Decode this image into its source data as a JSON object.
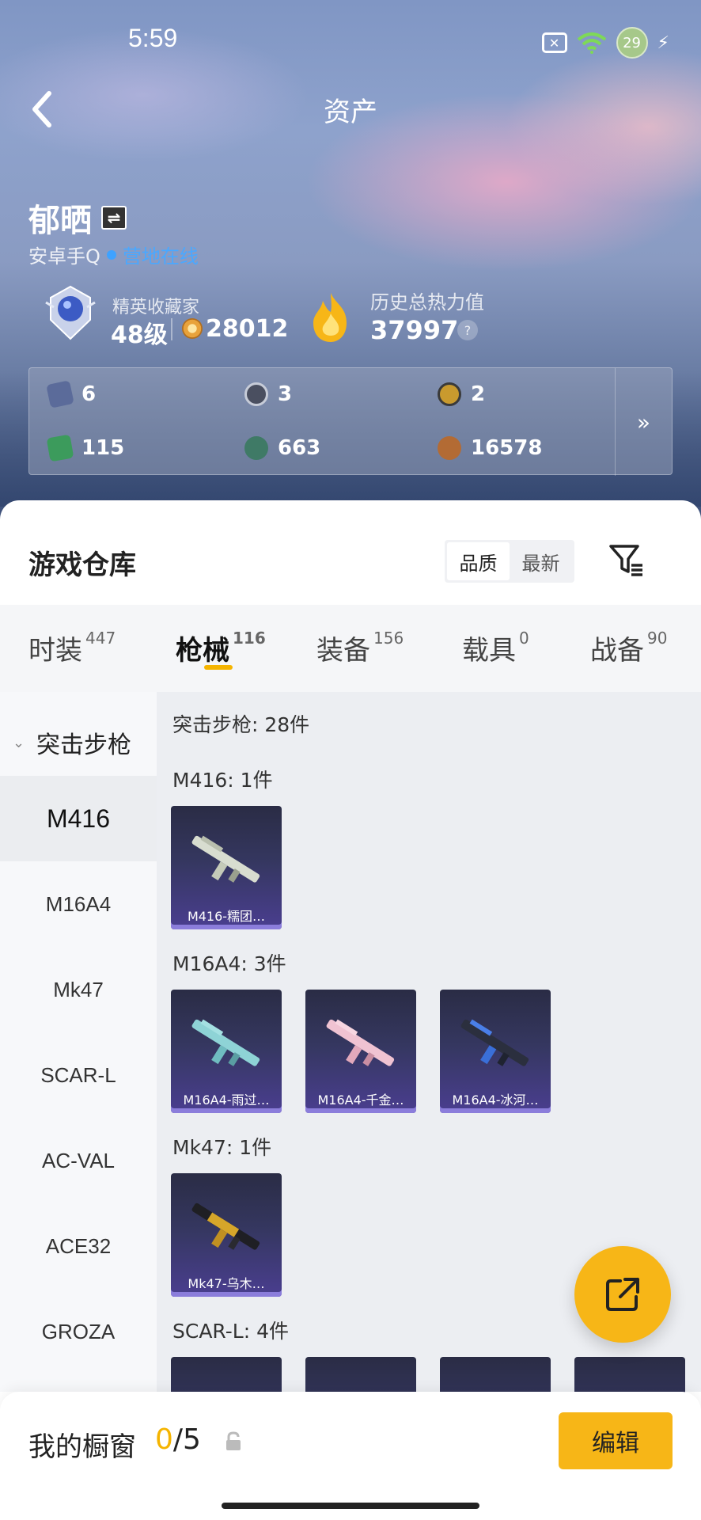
{
  "status": {
    "time": "5:59",
    "battery": "29"
  },
  "header": {
    "title": "资产"
  },
  "profile": {
    "name": "郁晒",
    "platform": "安卓手Q",
    "online_status": "营地在线",
    "rank_title": "精英收藏家",
    "level": "48级",
    "coins": "28012",
    "heat_title": "历史总热力值",
    "heat_value": "37997",
    "help": "?"
  },
  "resources": [
    {
      "icon": "card-icon",
      "value": "6",
      "color": "#5b6b9a"
    },
    {
      "icon": "badge-icon",
      "value": "3",
      "color": "#4a4f60"
    },
    {
      "icon": "gold-medal-icon",
      "value": "2",
      "color": "#c99a2e"
    },
    {
      "icon": "green-card-icon",
      "value": "115",
      "color": "#3c9b5c"
    },
    {
      "icon": "gem-icon",
      "value": "663",
      "color": "#3f7a66"
    },
    {
      "icon": "bronze-token-icon",
      "value": "16578",
      "color": "#b36b34"
    }
  ],
  "resources_more": "»",
  "warehouse": {
    "title": "游戏仓库",
    "sort_options": [
      "品质",
      "最新"
    ],
    "active_sort": 0
  },
  "tabs": [
    {
      "label": "时装",
      "count": "447"
    },
    {
      "label": "枪械",
      "count": "116"
    },
    {
      "label": "装备",
      "count": "156"
    },
    {
      "label": "载具",
      "count": "0"
    },
    {
      "label": "战备",
      "count": "90"
    }
  ],
  "sidebar": {
    "category": "突击步枪",
    "items": [
      "M416",
      "M16A4",
      "Mk47",
      "SCAR-L",
      "AC-VAL",
      "ACE32",
      "GROZA"
    ]
  },
  "content": {
    "summary": "突击步枪: 28件",
    "groups": [
      {
        "label": "M416: 1件",
        "items": [
          "M416-糯团…"
        ]
      },
      {
        "label": "M16A4: 3件",
        "items": [
          "M16A4-雨过…",
          "M16A4-千金…",
          "M16A4-冰河…"
        ]
      },
      {
        "label": "Mk47: 1件",
        "items": [
          "Mk47-乌木…"
        ]
      },
      {
        "label": "SCAR-L: 4件",
        "items": [
          "",
          "",
          "",
          ""
        ]
      }
    ]
  },
  "bottom": {
    "label": "我的橱窗",
    "count_current": "0",
    "count_total": "/5",
    "edit_label": "编辑"
  },
  "colors": {
    "accent": "#f7b617",
    "online": "#3ea2ff"
  }
}
